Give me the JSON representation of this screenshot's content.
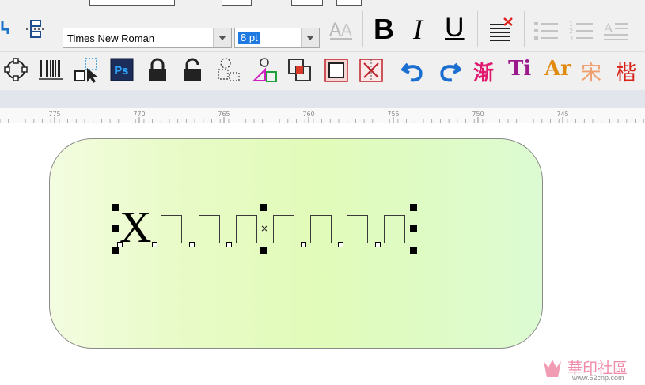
{
  "toolbar": {
    "font_name": "Times New Roman",
    "font_size": "8 pt",
    "bold_label": "B",
    "italic_label": "I",
    "underline_label": "U",
    "chinese_effects": [
      "渐",
      "Ti",
      "Ar",
      "宋",
      "楷"
    ]
  },
  "ruler": {
    "labels": [
      "775",
      "770",
      "765",
      "760",
      "755",
      "750",
      "745"
    ]
  },
  "canvas": {
    "text_first_char": "X",
    "placeholder_glyph_count": 7,
    "center_marker": "×",
    "shape_gradient": [
      "#f3fce0",
      "#e1fbb9",
      "#dcfbd2"
    ]
  },
  "watermark": {
    "title": "華印社區",
    "url": "www.52cnp.com"
  }
}
